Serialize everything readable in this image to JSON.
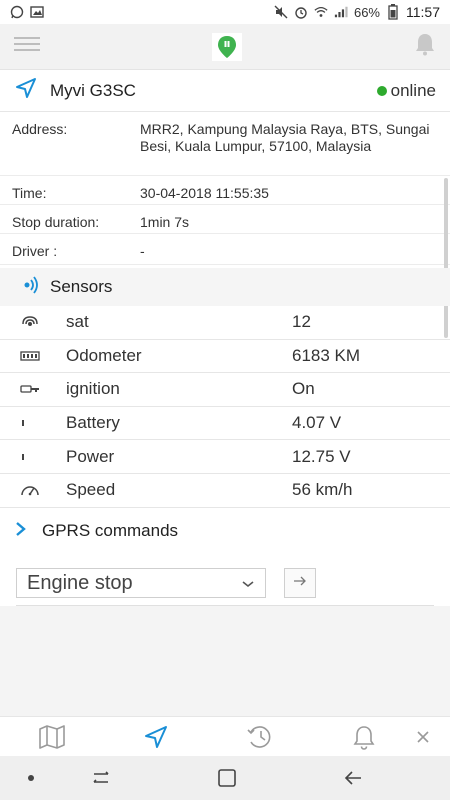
{
  "status_bar": {
    "battery_percent": "66%",
    "time": "11:57"
  },
  "device": {
    "name": "Myvi G3SC",
    "status": "online",
    "status_color": "#2eaa2e"
  },
  "info": [
    {
      "label": "Address:",
      "value": "MRR2, Kampung Malaysia Raya, BTS, Sungai Besi, Kuala Lumpur, 57100, Malaysia"
    },
    {
      "label": "Time:",
      "value": "30-04-2018 11:55:35"
    },
    {
      "label": "Stop duration:",
      "value": "1min 7s"
    },
    {
      "label": "Driver :",
      "value": "-"
    }
  ],
  "sensors": {
    "title": "Sensors",
    "items": [
      {
        "name": "sat",
        "value": "12",
        "icon": "satellite-icon"
      },
      {
        "name": "Odometer",
        "value": "6183 KM",
        "icon": "odometer-icon"
      },
      {
        "name": "ignition",
        "value": "On",
        "icon": "key-icon"
      },
      {
        "name": "Battery",
        "value": "4.07 V",
        "icon": "battery-icon"
      },
      {
        "name": "Power",
        "value": "12.75 V",
        "icon": "power-icon"
      },
      {
        "name": "Speed",
        "value": "56 km/h",
        "icon": "speedometer-icon"
      }
    ]
  },
  "gprs": {
    "title": "GPRS commands",
    "selected_command": "Engine stop"
  },
  "colors": {
    "accent": "#1a8fd6",
    "brand": "#3fb34f"
  }
}
